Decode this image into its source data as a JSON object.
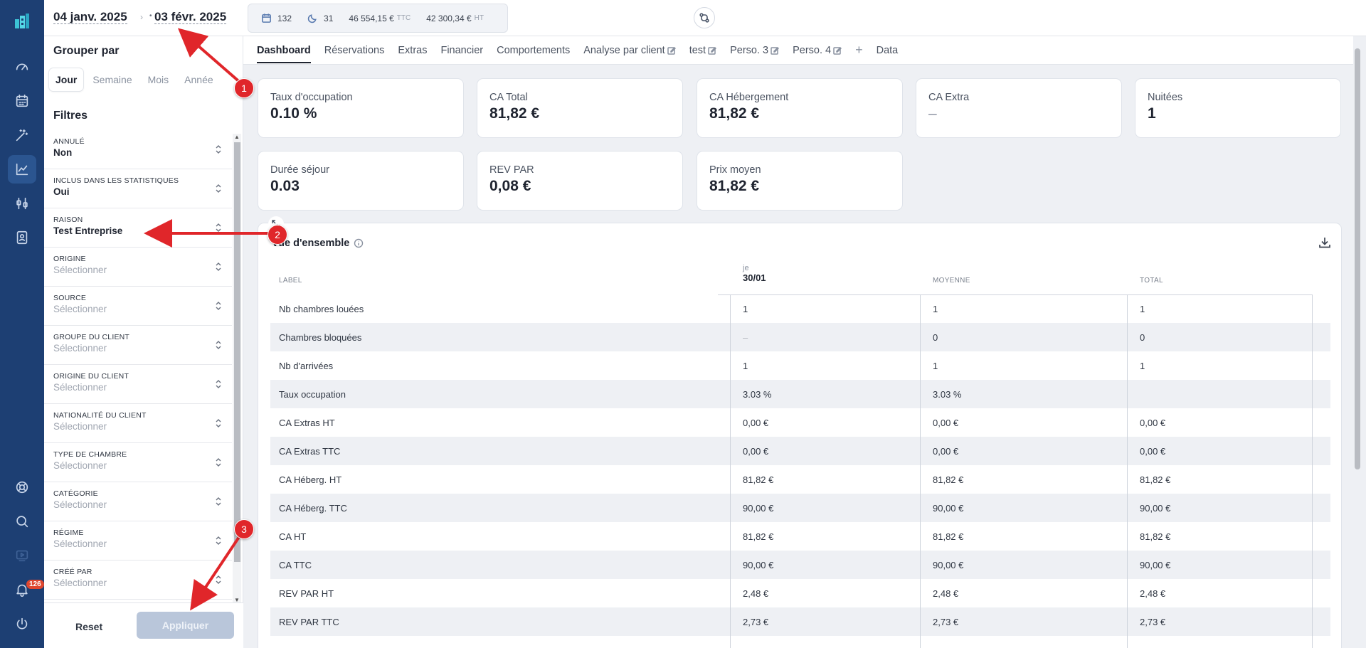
{
  "topbar": {
    "date_start": "04 janv. 2025",
    "date_end": "03 févr. 2025",
    "stat_nights": "132",
    "stat_stays": "31",
    "stat_ttc_value": "46 554,15 €",
    "stat_ttc_suffix": "TTC",
    "stat_ht_value": "42 300,34 €",
    "stat_ht_suffix": "HT"
  },
  "panel": {
    "group_title": "Grouper par",
    "group_tabs": [
      "Jour",
      "Semaine",
      "Mois",
      "Année"
    ],
    "filters_title": "Filtres",
    "filters": [
      {
        "label": "ANNULÉ",
        "value": "Non"
      },
      {
        "label": "INCLUS DANS LES STATISTIQUES",
        "value": "Oui"
      },
      {
        "label": "RAISON",
        "value": "Test Entreprise"
      },
      {
        "label": "ORIGINE",
        "value": "Sélectionner"
      },
      {
        "label": "SOURCE",
        "value": "Sélectionner"
      },
      {
        "label": "GROUPE DU CLIENT",
        "value": "Sélectionner"
      },
      {
        "label": "ORIGINE DU CLIENT",
        "value": "Sélectionner"
      },
      {
        "label": "NATIONALITÉ DU CLIENT",
        "value": "Sélectionner"
      },
      {
        "label": "TYPE DE CHAMBRE",
        "value": "Sélectionner"
      },
      {
        "label": "CATÉGORIE",
        "value": "Sélectionner"
      },
      {
        "label": "RÉGIME",
        "value": "Sélectionner"
      },
      {
        "label": "CRÉÉ PAR",
        "value": "Sélectionner"
      }
    ],
    "reset_label": "Reset",
    "apply_label": "Appliquer"
  },
  "tabs": [
    "Dashboard",
    "Réservations",
    "Extras",
    "Financier",
    "Comportements",
    "Analyse par client",
    "test",
    "Perso. 3",
    "Perso. 4",
    "+",
    "Data"
  ],
  "kpis": [
    {
      "label": "Taux d'occupation",
      "value": "0.10 %"
    },
    {
      "label": "CA Total",
      "value": "81,82 €"
    },
    {
      "label": "CA Hébergement",
      "value": "81,82 €"
    },
    {
      "label": "CA Extra",
      "value": "–"
    },
    {
      "label": "Nuitées",
      "value": "1"
    },
    {
      "label": "Durée séjour",
      "value": "0.03"
    },
    {
      "label": "REV PAR",
      "value": "0,08 €"
    },
    {
      "label": "Prix moyen",
      "value": "81,82 €"
    }
  ],
  "overview": {
    "title": "Vue d'ensemble",
    "col_label": "LABEL",
    "col_day_weekday": "je",
    "col_day_date": "30/01",
    "col_avg": "MOYENNE",
    "col_total": "TOTAL",
    "rows": [
      {
        "label": "Nb chambres louées",
        "day": "1",
        "avg": "1",
        "total": "1"
      },
      {
        "label": "Chambres bloquées",
        "day": "–",
        "avg": "0",
        "total": "0"
      },
      {
        "label": "Nb d'arrivées",
        "day": "1",
        "avg": "1",
        "total": "1"
      },
      {
        "label": "Taux occupation",
        "day": "3.03 %",
        "avg": "3.03 %",
        "total": ""
      },
      {
        "label": "CA Extras HT",
        "day": "0,00 €",
        "avg": "0,00 €",
        "total": "0,00 €"
      },
      {
        "label": "CA Extras TTC",
        "day": "0,00 €",
        "avg": "0,00 €",
        "total": "0,00 €"
      },
      {
        "label": "CA Héberg. HT",
        "day": "81,82 €",
        "avg": "81,82 €",
        "total": "81,82 €"
      },
      {
        "label": "CA Héberg. TTC",
        "day": "90,00 €",
        "avg": "90,00 €",
        "total": "90,00 €"
      },
      {
        "label": "CA HT",
        "day": "81,82 €",
        "avg": "81,82 €",
        "total": "81,82 €"
      },
      {
        "label": "CA TTC",
        "day": "90,00 €",
        "avg": "90,00 €",
        "total": "90,00 €"
      },
      {
        "label": "REV PAR HT",
        "day": "2,48 €",
        "avg": "2,48 €",
        "total": "2,48 €"
      },
      {
        "label": "REV PAR TTC",
        "day": "2,73 €",
        "avg": "2,73 €",
        "total": "2,73 €"
      }
    ]
  },
  "notifications_count": "126",
  "annotations": [
    "1",
    "2",
    "3"
  ],
  "colors": {
    "rail": "#1d3f73",
    "annotation": "#e0262a",
    "apply_disabled": "#b9c6da"
  }
}
